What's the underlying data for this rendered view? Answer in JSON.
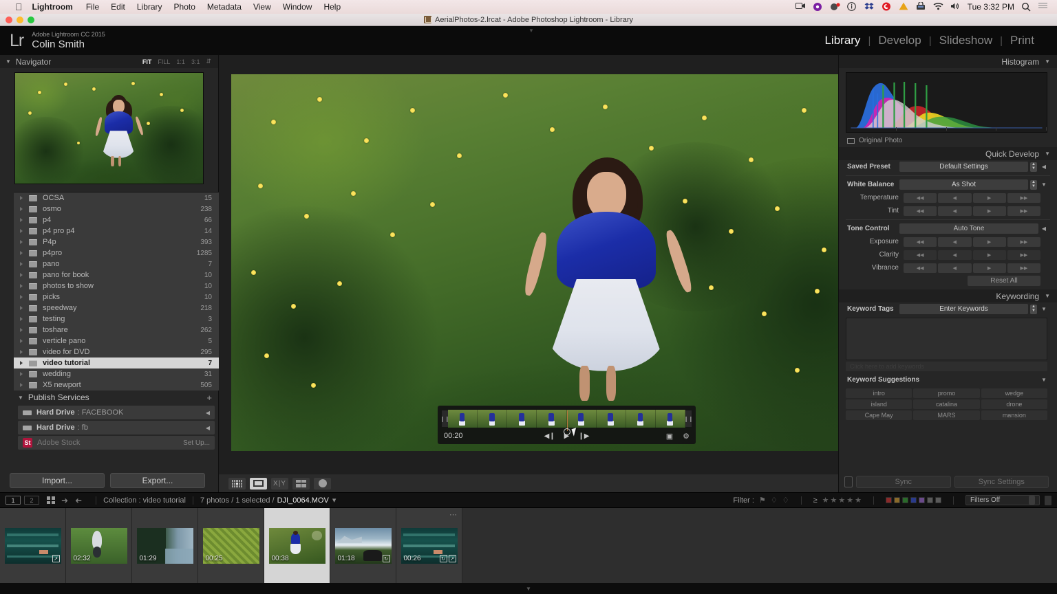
{
  "macmenu": {
    "apple": "apple-logo",
    "items": [
      "Lightroom",
      "File",
      "Edit",
      "Library",
      "Photo",
      "Metadata",
      "View",
      "Window",
      "Help"
    ],
    "clock": "Tue 3:32 PM",
    "status_icons": [
      "screen-recording-icon",
      "sync-icon",
      "bluetooth-share-icon",
      "info-icon",
      "dropbox-icon",
      "creative-cloud-icon",
      "warning-icon",
      "vpn-icon",
      "wifi-icon",
      "volume-icon"
    ],
    "search_icon": "search-icon",
    "notification_icon": "notification-center-icon"
  },
  "window": {
    "title": "AerialPhotos-2.lrcat - Adobe Photoshop Lightroom - Library",
    "catalog_icon": "lightroom-catalog-icon"
  },
  "identity": {
    "logo": "Lr",
    "product": "Adobe Lightroom CC 2015",
    "user": "Colin Smith",
    "modules": [
      {
        "label": "Library",
        "active": true
      },
      {
        "label": "Develop",
        "active": false
      },
      {
        "label": "Slideshow",
        "active": false
      },
      {
        "label": "Print",
        "active": false
      }
    ]
  },
  "navigator": {
    "title": "Navigator",
    "zoom_levels": [
      {
        "label": "FIT",
        "active": true
      },
      {
        "label": "FILL",
        "active": false
      },
      {
        "label": "1:1",
        "active": false
      },
      {
        "label": "3:1",
        "active": false
      }
    ]
  },
  "folders": [
    {
      "name": "OCSA",
      "count": "15",
      "selected": false
    },
    {
      "name": "osmo",
      "count": "238",
      "selected": false
    },
    {
      "name": "p4",
      "count": "66",
      "selected": false
    },
    {
      "name": "p4 pro p4",
      "count": "14",
      "selected": false
    },
    {
      "name": "P4p",
      "count": "393",
      "selected": false
    },
    {
      "name": "p4pro",
      "count": "1285",
      "selected": false
    },
    {
      "name": "pano",
      "count": "7",
      "selected": false
    },
    {
      "name": "pano for book",
      "count": "10",
      "selected": false
    },
    {
      "name": "photos to show",
      "count": "10",
      "selected": false
    },
    {
      "name": "picks",
      "count": "10",
      "selected": false
    },
    {
      "name": "speedway",
      "count": "218",
      "selected": false
    },
    {
      "name": "testing",
      "count": "3",
      "selected": false
    },
    {
      "name": "toshare",
      "count": "262",
      "selected": false
    },
    {
      "name": "verticle pano",
      "count": "5",
      "selected": false
    },
    {
      "name": "video for DVD",
      "count": "295",
      "selected": false
    },
    {
      "name": "video tutorial",
      "count": "7",
      "selected": true
    },
    {
      "name": "wedding",
      "count": "31",
      "selected": false
    },
    {
      "name": "X5 newport",
      "count": "505",
      "selected": false
    }
  ],
  "publish": {
    "title": "Publish Services",
    "add_icon": "plus-icon",
    "services": [
      {
        "type": "Hard Drive",
        "name": "FACEBOOK",
        "icon": "hard-drive-icon"
      },
      {
        "type": "Hard Drive",
        "name": "fb",
        "icon": "hard-drive-icon"
      }
    ],
    "stock": {
      "badge": "St",
      "name": "Adobe Stock",
      "action": "Set Up..."
    }
  },
  "left_buttons": {
    "import": "Import...",
    "export": "Export..."
  },
  "viewmodes": [
    {
      "name": "grid-view-button",
      "icon": "grid-icon",
      "active": false
    },
    {
      "name": "loupe-view-button",
      "icon": "loupe-icon",
      "active": true
    },
    {
      "name": "compare-view-button",
      "icon": "compare-xy-icon",
      "active": false
    },
    {
      "name": "survey-view-button",
      "icon": "survey-icon",
      "active": false
    },
    {
      "name": "people-view-button",
      "icon": "face-icon",
      "active": false
    }
  ],
  "video": {
    "current_time": "00:20",
    "prev_frame_icon": "step-back-icon",
    "play_icon": "play-icon",
    "next_frame_icon": "step-forward-icon",
    "frame_capture_icon": "frame-capture-icon",
    "settings_icon": "gear-icon",
    "trim_start_icon": "trim-start-handle",
    "trim_end_icon": "trim-end-handle",
    "playhead_position_pct": 50
  },
  "histogram": {
    "title": "Histogram",
    "original_photo_label": "Original Photo"
  },
  "quick_develop": {
    "title": "Quick Develop",
    "saved_preset_label": "Saved Preset",
    "saved_preset_value": "Default Settings",
    "white_balance_label": "White Balance",
    "white_balance_value": "As Shot",
    "temperature_label": "Temperature",
    "tint_label": "Tint",
    "tone_control_label": "Tone Control",
    "auto_tone_label": "Auto Tone",
    "exposure_label": "Exposure",
    "clarity_label": "Clarity",
    "vibrance_label": "Vibrance",
    "reset_all_label": "Reset All"
  },
  "keywording": {
    "title": "Keywording",
    "tags_label": "Keyword Tags",
    "tags_value": "Enter Keywords",
    "hint": "Click here to add keywords",
    "suggestions_title": "Keyword Suggestions",
    "suggestions": [
      "intro",
      "promo",
      "wedge",
      "island",
      "catalina",
      "drone",
      "Cape May",
      "MARS",
      "mansion"
    ]
  },
  "sync": {
    "sync_label": "Sync",
    "sync_settings_label": "Sync Settings",
    "lock_icon": "auto-sync-lock-icon"
  },
  "filterbar": {
    "page_1": "1",
    "page_2": "2",
    "grid_icon": "grid-toggle-icon",
    "back_icon": "arrow-left-icon",
    "forward_icon": "arrow-right-icon",
    "collection_label": "Collection : video tutorial",
    "selection_label": "7 photos / 1 selected /",
    "current_file": "DJI_0064.MOV",
    "filter_label": "Filter :",
    "flags": [
      "flag-picked-icon",
      "flag-unflagged-icon",
      "flag-rejected-icon"
    ],
    "rating_operator": "≥",
    "stars": 5,
    "color_labels": [
      "#8a2a2a",
      "#8a6a2a",
      "#2a6a2a",
      "#2a3a8a",
      "#6a4a8a",
      "#5a5a5a",
      "#5a5a5a"
    ],
    "filters_preset": "Filters Off"
  },
  "filmstrip": [
    {
      "duration": "",
      "selected": false,
      "kind": "aerial-teal",
      "badges": [
        "edit-badge"
      ]
    },
    {
      "duration": "02:32",
      "selected": false,
      "kind": "green-aerial",
      "badges": []
    },
    {
      "duration": "01:29",
      "selected": false,
      "kind": "coast-cliff",
      "badges": []
    },
    {
      "duration": "00:25",
      "selected": false,
      "kind": "canopy",
      "badges": []
    },
    {
      "duration": "00:38",
      "selected": true,
      "kind": "girl-flowers",
      "badges": []
    },
    {
      "duration": "01:18",
      "selected": false,
      "kind": "beach-horizon",
      "badges": [
        "crop-badge"
      ]
    },
    {
      "duration": "00:26",
      "selected": false,
      "kind": "aerial-teal",
      "badges": [
        "crop-badge",
        "edit-badge"
      ]
    }
  ],
  "colors": {
    "panel_bg": "#262626",
    "selection": "#d6d6d6",
    "accent_blue": "#1b2da8",
    "stock_red": "#b0143c",
    "playhead": "#b8763b"
  }
}
